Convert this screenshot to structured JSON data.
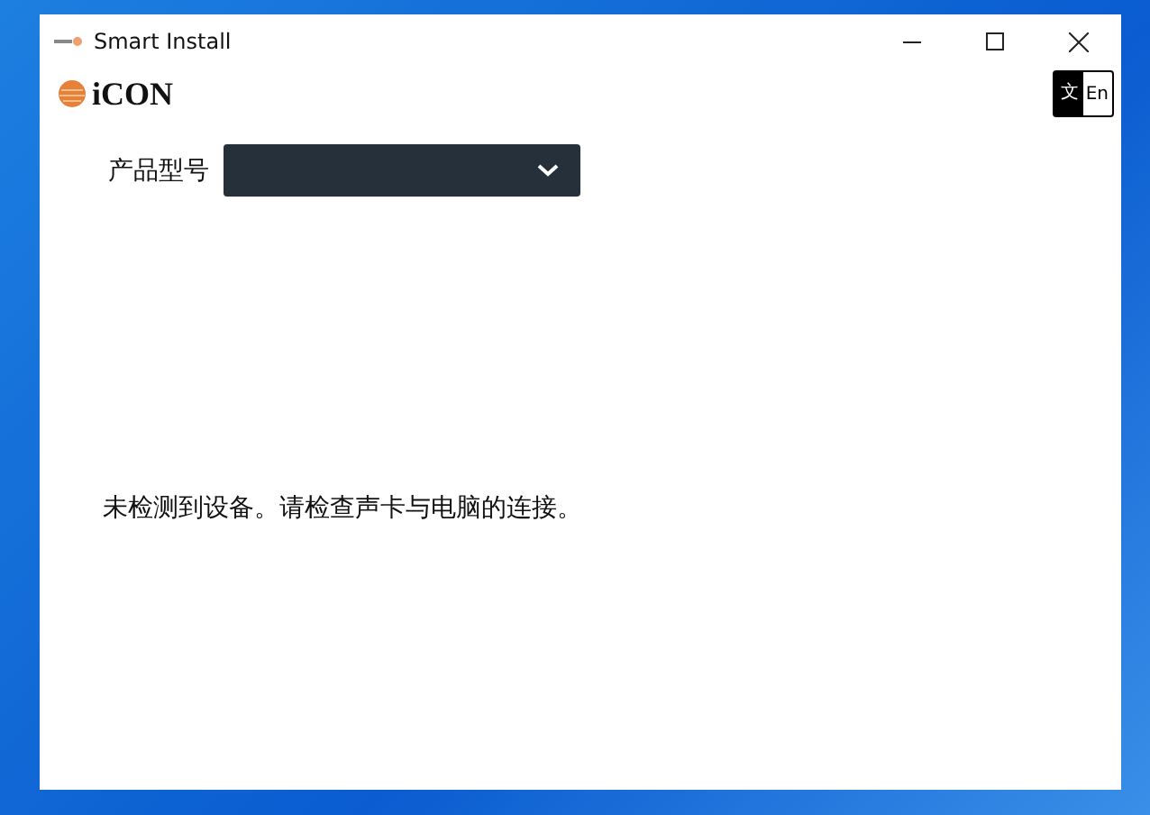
{
  "window": {
    "title": "Smart Install"
  },
  "logo": {
    "text": "iCON"
  },
  "language_toggle": {
    "left": "文",
    "right": "En"
  },
  "model_field": {
    "label": "产品型号"
  },
  "message": "未检测到设备。请检查声卡与电脑的连接。"
}
